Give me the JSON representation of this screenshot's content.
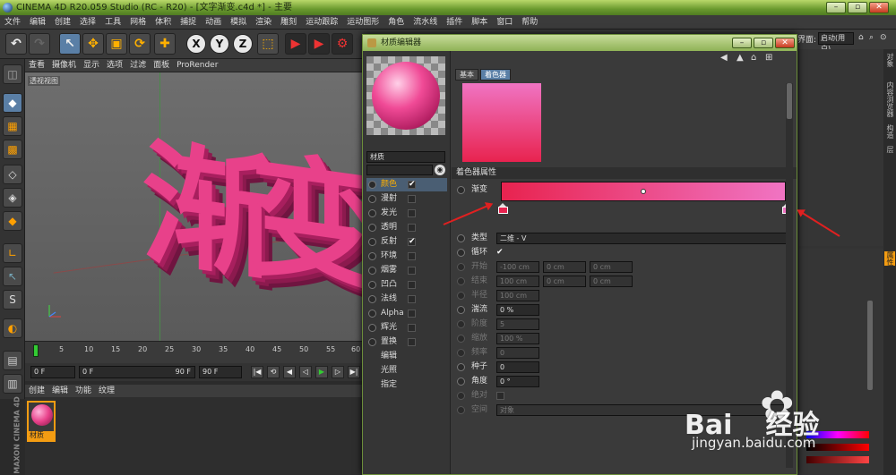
{
  "app": {
    "title": "CINEMA 4D R20.059 Studio (RC - R20) - [文字渐变.c4d *] - 主要"
  },
  "menu": [
    "文件",
    "编辑",
    "创建",
    "选择",
    "工具",
    "网格",
    "体积",
    "捕捉",
    "动画",
    "模拟",
    "渲染",
    "雕刻",
    "运动跟踪",
    "运动图形",
    "角色",
    "流水线",
    "插件",
    "脚本",
    "窗口",
    "帮助"
  ],
  "layout": {
    "label": "界面:",
    "value": "启动(用户)"
  },
  "toolbar": {
    "x": "X",
    "y": "Y",
    "z": "Z"
  },
  "viewport": {
    "menu": [
      "查看",
      "摄像机",
      "显示",
      "选项",
      "过滤",
      "面板",
      "ProRender"
    ],
    "label": "透视视图",
    "text3d": [
      "渐",
      "变"
    ]
  },
  "timeline": {
    "ticks": [
      "0",
      "5",
      "10",
      "15",
      "20",
      "25",
      "30",
      "35",
      "40",
      "45",
      "50",
      "55",
      "60"
    ],
    "start": "0 F",
    "current": "0 F",
    "end_inner": "90 F",
    "end": "90 F"
  },
  "materials": {
    "menu": [
      "创建",
      "编辑",
      "功能",
      "纹理"
    ],
    "item_name": "材质"
  },
  "brand": "MAXON CINEMA 4D",
  "editor": {
    "title": "材质编辑器",
    "material_name": "材质",
    "channels": [
      {
        "label": "颜色",
        "checked": true,
        "selected": true
      },
      {
        "label": "漫射",
        "checked": false
      },
      {
        "label": "发光",
        "checked": false
      },
      {
        "label": "透明",
        "checked": false
      },
      {
        "label": "反射",
        "checked": true
      },
      {
        "label": "环境",
        "checked": false
      },
      {
        "label": "烟雾",
        "checked": false
      },
      {
        "label": "凹凸",
        "checked": false
      },
      {
        "label": "法线",
        "checked": false
      },
      {
        "label": "Alpha",
        "checked": false
      },
      {
        "label": "辉光",
        "checked": false
      },
      {
        "label": "置换",
        "checked": false
      }
    ],
    "extra": [
      "编辑",
      "光照",
      "指定"
    ],
    "tabs": [
      "基本",
      "着色器"
    ],
    "section": "着色器属性",
    "gradient_label": "渐变",
    "gradient_colors": [
      "#e8234f",
      "#f074c3"
    ],
    "type": {
      "label": "类型",
      "value": "二维 - V"
    },
    "cycle": {
      "label": "循环",
      "check": "✔"
    },
    "start": {
      "label": "开始",
      "v": [
        "-100 cm",
        "0 cm",
        "0 cm"
      ]
    },
    "end": {
      "label": "结束",
      "v": [
        "100 cm",
        "0 cm",
        "0 cm"
      ]
    },
    "radius": {
      "label": "半径",
      "value": "100 cm"
    },
    "turbulence": {
      "label": "湍流",
      "value": "0 %"
    },
    "octaves": {
      "label": "阶度",
      "value": "5"
    },
    "scale": {
      "label": "缩放",
      "value": "100 %"
    },
    "frequency": {
      "label": "频率",
      "value": "0"
    },
    "seed": {
      "label": "种子",
      "value": "0"
    },
    "angle": {
      "label": "角度",
      "value": "0 °"
    },
    "absolute": {
      "label": "绝对"
    },
    "space": {
      "label": "空间",
      "value": "对象"
    }
  },
  "right_tabs": [
    "对象",
    "内容浏览器",
    "构造",
    "层",
    "属性"
  ],
  "watermark": {
    "brand": "Bai",
    "brand2": "经验",
    "url": "jingyan.baidu.com"
  }
}
